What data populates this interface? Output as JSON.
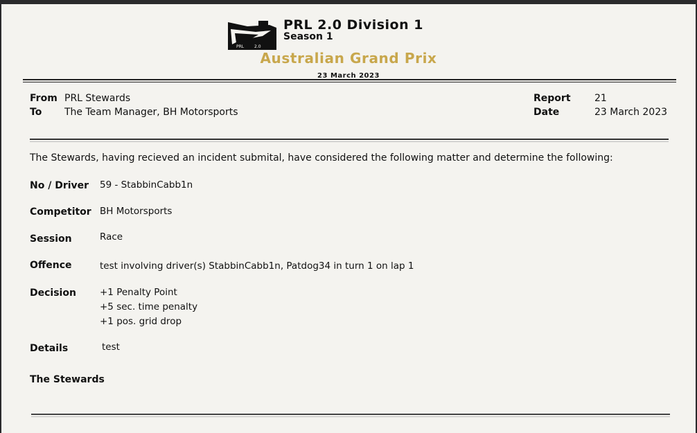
{
  "header": {
    "logo_text": [
      "PRL",
      "2.0"
    ],
    "title": "PRL 2.0 Division 1",
    "season": "Season 1",
    "event": "Australian Grand Prix",
    "event_date": "23 March 2023"
  },
  "meta": {
    "from_label": "From",
    "from_value": "PRL Stewards",
    "to_label": "To",
    "to_value": "The Team Manager, BH Motorsports",
    "report_label": "Report",
    "report_value": "21",
    "date_label": "Date",
    "date_value": "23 March 2023"
  },
  "intro": "The Stewards, having recieved an incident submital, have considered the following matter and determine the following:",
  "fields": {
    "driver_label": "No / Driver",
    "driver_value": "59 - StabbinCabb1n",
    "competitor_label": "Competitor",
    "competitor_value": "BH Motorsports",
    "session_label": "Session",
    "session_value": "Race",
    "offence_label": "Offence",
    "offence_value": "test involving driver(s) StabbinCabb1n, Patdog34 in turn 1 on lap 1",
    "decision_label": "Decision",
    "decision_values": [
      "+1 Penalty Point",
      "+5 sec. time penalty",
      "+1 pos. grid drop"
    ],
    "details_label": "Details",
    "details_value": "test"
  },
  "signature": "The Stewards",
  "colors": {
    "gold": "#c8a74c",
    "paper": "#f4f3ef",
    "frame": "#2a2a2c"
  }
}
